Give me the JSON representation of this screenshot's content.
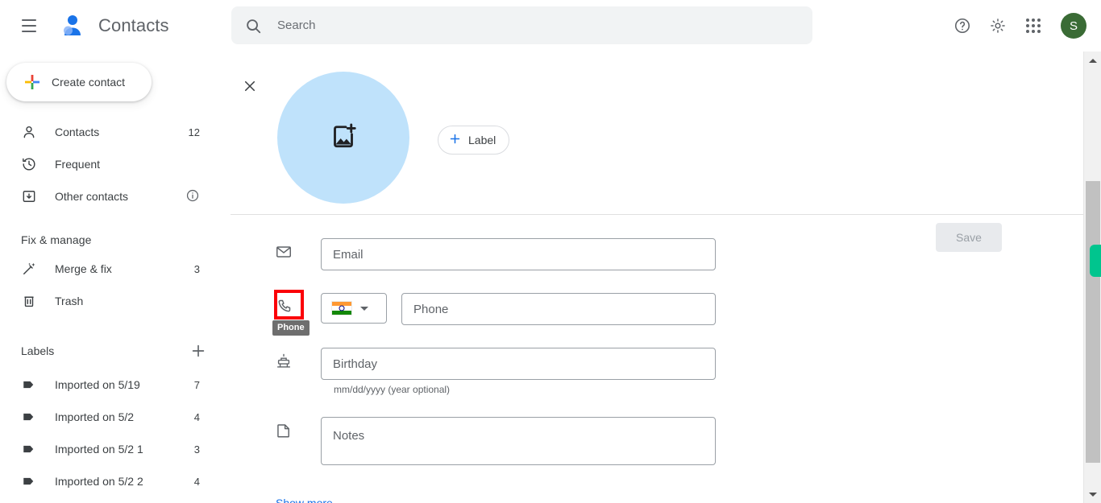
{
  "app": {
    "title": "Contacts",
    "brand_icon": "contacts-person-icon",
    "accent_blue": "#1a73e8",
    "avatar_bg": "#3a6b35",
    "photo_bg": "#bfe2fb",
    "highlight_color": "#fb0007",
    "scroll_marker_color": "#00c58e"
  },
  "header": {
    "menu_icon": "hamburger-menu-icon",
    "search": {
      "icon": "search-icon",
      "placeholder": "Search",
      "value": ""
    },
    "actions": [
      {
        "name": "help-icon",
        "label": "Help"
      },
      {
        "name": "settings-gear-icon",
        "label": "Settings"
      },
      {
        "name": "google-apps-grid-icon",
        "label": "Google apps"
      }
    ],
    "avatar": {
      "initial": "S",
      "name": "account-avatar"
    }
  },
  "sidebar": {
    "create_button": {
      "label": "Create contact",
      "icon": "plus-multicolor-icon"
    },
    "nav_items": [
      {
        "label": "Contacts",
        "count": "12",
        "icon": "person-outline-icon",
        "name": "sidebar-item-contacts"
      },
      {
        "label": "Frequent",
        "count": "",
        "icon": "history-clock-icon",
        "name": "sidebar-item-frequent"
      },
      {
        "label": "Other contacts",
        "count": "",
        "icon": "archive-box-icon",
        "trailing_icon": "info-circle-icon",
        "name": "sidebar-item-other-contacts"
      }
    ],
    "fix_manage_title": "Fix & manage",
    "fix_manage_items": [
      {
        "label": "Merge & fix",
        "count": "3",
        "icon": "magic-wand-icon",
        "name": "sidebar-item-merge-fix"
      },
      {
        "label": "Trash",
        "count": "",
        "icon": "trash-icon",
        "name": "sidebar-item-trash"
      }
    ],
    "labels_title": "Labels",
    "labels_add_icon": "plus-icon",
    "labels": [
      {
        "label": "Imported on 5/19",
        "count": "7",
        "icon": "label-tag-icon"
      },
      {
        "label": "Imported on 5/2",
        "count": "4",
        "icon": "label-tag-icon"
      },
      {
        "label": "Imported on 5/2 1",
        "count": "3",
        "icon": "label-tag-icon"
      },
      {
        "label": "Imported on 5/2 2",
        "count": "4",
        "icon": "label-tag-icon"
      }
    ]
  },
  "main": {
    "close_icon": "close-x-icon",
    "photo": {
      "icon": "add-photo-icon"
    },
    "label_button": {
      "label": "Label",
      "icon": "plus-icon"
    },
    "save_button": {
      "label": "Save",
      "disabled": true
    },
    "show_more": "Show more",
    "fields": [
      {
        "name": "email-field",
        "icon": "envelope-icon",
        "placeholder": "Email",
        "value": ""
      },
      {
        "name": "phone-field",
        "icon": "phone-icon",
        "placeholder": "Phone",
        "value": "",
        "country_selector": {
          "flag": "india-flag",
          "caret": "chevron-down-icon"
        },
        "tooltip": "Phone",
        "highlighted": true
      },
      {
        "name": "birthday-field",
        "icon": "birthday-cake-icon",
        "placeholder": "Birthday",
        "value": "",
        "helper": "mm/dd/yyyy (year optional)"
      },
      {
        "name": "notes-field",
        "icon": "note-page-icon",
        "placeholder": "Notes",
        "value": ""
      }
    ]
  },
  "scrollbar": {
    "up_arrow": "scroll-up-arrow",
    "down_arrow": "scroll-down-arrow",
    "thumb": "scroll-thumb",
    "marker": "scroll-position-marker"
  }
}
